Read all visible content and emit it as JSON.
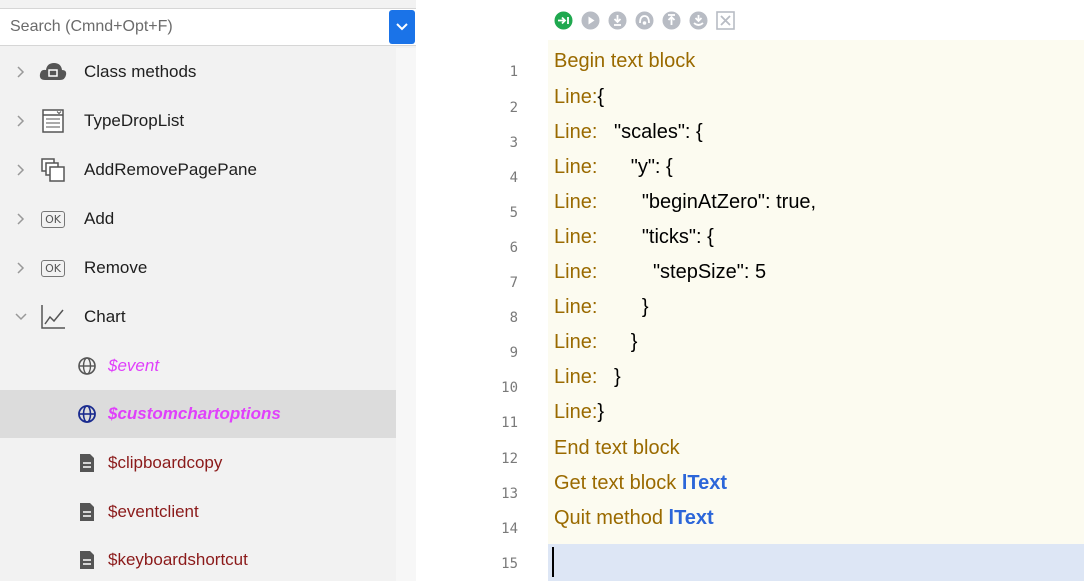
{
  "search": {
    "placeholder": "Search (Cmnd+Opt+F)"
  },
  "tree": {
    "objects": [
      {
        "label": "Class methods",
        "icon": "cloud-icon"
      },
      {
        "label": "TypeDropList",
        "icon": "droplist-icon"
      },
      {
        "label": "AddRemovePagePane",
        "icon": "pagepane-icon"
      },
      {
        "label": "Add",
        "icon": "ok-button-icon",
        "icon_text": "OK"
      },
      {
        "label": "Remove",
        "icon": "ok-button-icon",
        "icon_text": "OK"
      },
      {
        "label": "Chart",
        "icon": "chart-icon"
      }
    ],
    "methods": [
      {
        "label": "$event",
        "icon": "globe-icon",
        "style": "event"
      },
      {
        "label": "$customchartoptions",
        "icon": "globe-icon",
        "style": "custom",
        "selected": true
      },
      {
        "label": "$clipboardcopy",
        "icon": "document-icon",
        "style": "normal"
      },
      {
        "label": "$eventclient",
        "icon": "document-icon",
        "style": "normal"
      },
      {
        "label": "$keyboardshortcut",
        "icon": "document-icon",
        "style": "normal"
      }
    ]
  },
  "toolbar": {
    "buttons": [
      "step-over-icon",
      "run-icon",
      "step-in-icon",
      "trace-icon",
      "step-out-icon",
      "breakpoint-icon",
      "stop-icon"
    ]
  },
  "editor": {
    "line_numbers": [
      "1",
      "2",
      "3",
      "4",
      "5",
      "6",
      "7",
      "8",
      "9",
      "10",
      "11",
      "12",
      "13",
      "14",
      "15"
    ],
    "lines": [
      {
        "kw": "Begin text block",
        "rest": "",
        "var": ""
      },
      {
        "kw": "Line:",
        "rest": "{",
        "var": ""
      },
      {
        "kw": "Line:",
        "rest": "   \"scales\": {",
        "var": ""
      },
      {
        "kw": "Line:",
        "rest": "      \"y\": {",
        "var": ""
      },
      {
        "kw": "Line:",
        "rest": "        \"beginAtZero\": true,",
        "var": ""
      },
      {
        "kw": "Line:",
        "rest": "        \"ticks\": {",
        "var": ""
      },
      {
        "kw": "Line:",
        "rest": "          \"stepSize\": 5",
        "var": ""
      },
      {
        "kw": "Line:",
        "rest": "        }",
        "var": ""
      },
      {
        "kw": "Line:",
        "rest": "      }",
        "var": ""
      },
      {
        "kw": "Line:",
        "rest": "   }",
        "var": ""
      },
      {
        "kw": "Line:",
        "rest": "}",
        "var": ""
      },
      {
        "kw": "End text block",
        "rest": "",
        "var": ""
      },
      {
        "kw": "Get text block",
        "rest": " ",
        "var": "lText"
      },
      {
        "kw": "Quit method",
        "rest": " ",
        "var": "lText"
      },
      {
        "kw": "",
        "rest": "",
        "var": ""
      }
    ]
  },
  "colors": {
    "keyword": "#9a6a00",
    "variable": "#2c66d9",
    "method_event": "#e040fb",
    "method_normal": "#8b1a1a",
    "toolbar_active": "#1fa84f",
    "toolbar_inactive": "#b8bcc4",
    "dropdown": "#1a73e8"
  }
}
